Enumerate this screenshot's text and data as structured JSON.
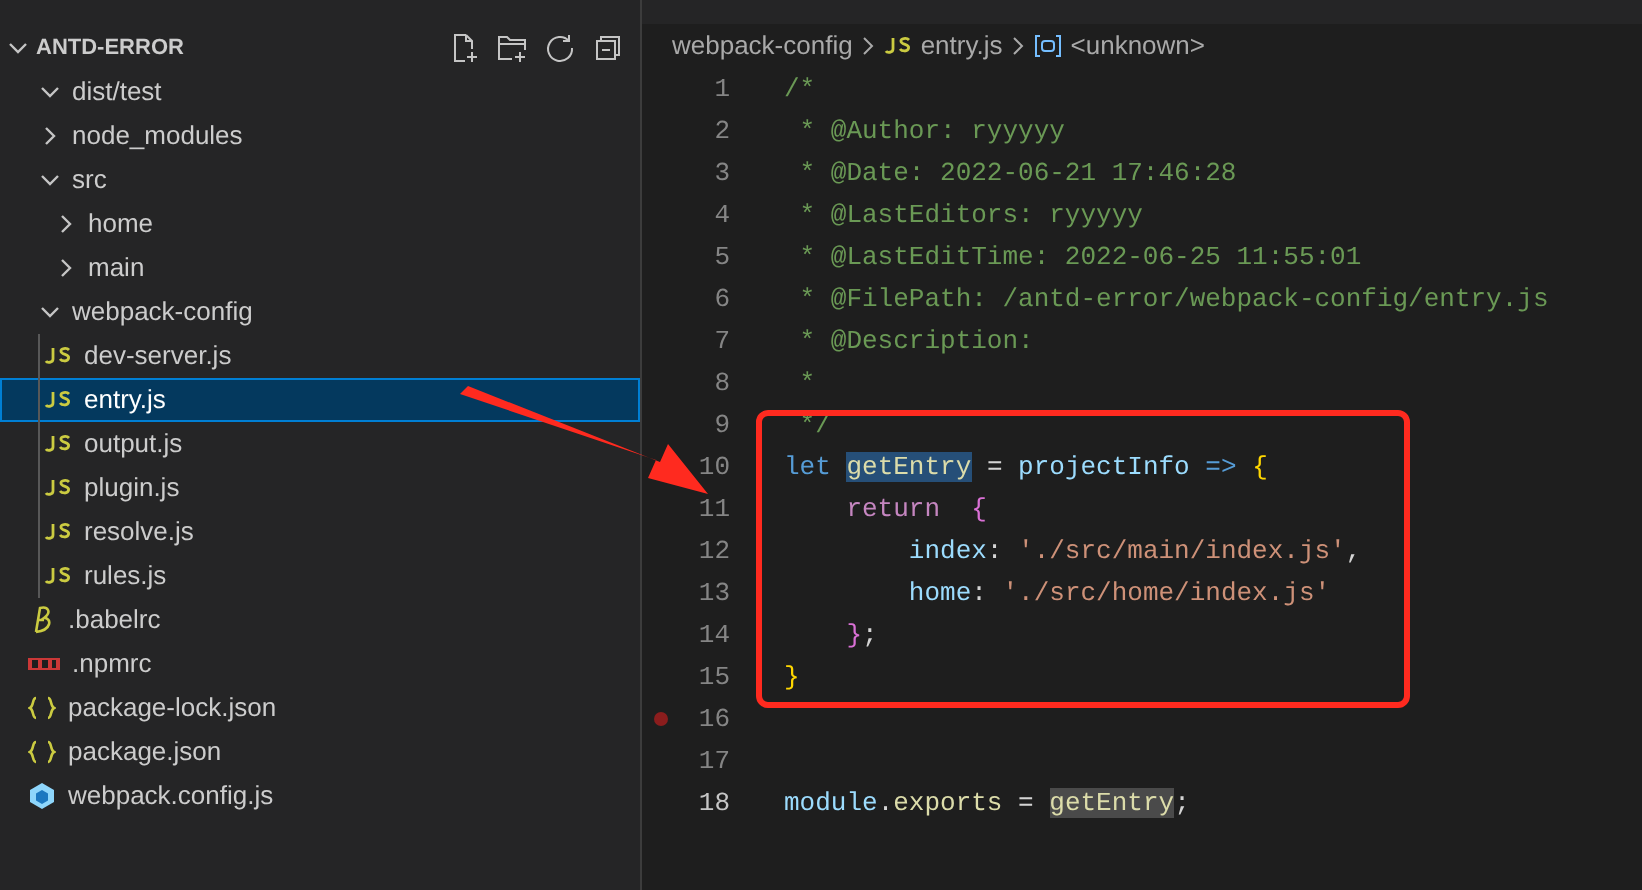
{
  "explorer": {
    "title": "ANTD-ERROR",
    "expanded": true,
    "tree": [
      {
        "name": "dist/test",
        "kind": "folder",
        "expanded": true,
        "selected": false
      },
      {
        "name": "node_modules",
        "kind": "folder",
        "expanded": false,
        "selected": false
      },
      {
        "name": "src",
        "kind": "folder",
        "expanded": true,
        "selected": false,
        "children": [
          {
            "name": "home",
            "kind": "folder",
            "expanded": false,
            "selected": false
          },
          {
            "name": "main",
            "kind": "folder",
            "expanded": false,
            "selected": false
          }
        ]
      },
      {
        "name": "webpack-config",
        "kind": "folder",
        "expanded": true,
        "selected": false,
        "children": [
          {
            "name": "dev-server.js",
            "kind": "js",
            "selected": false
          },
          {
            "name": "entry.js",
            "kind": "js",
            "selected": true
          },
          {
            "name": "output.js",
            "kind": "js",
            "selected": false
          },
          {
            "name": "plugin.js",
            "kind": "js",
            "selected": false
          },
          {
            "name": "resolve.js",
            "kind": "js",
            "selected": false
          },
          {
            "name": "rules.js",
            "kind": "js",
            "selected": false
          }
        ]
      },
      {
        "name": ".babelrc",
        "kind": "babel",
        "selected": false
      },
      {
        "name": ".npmrc",
        "kind": "npmrc",
        "selected": false
      },
      {
        "name": "package-lock.json",
        "kind": "json",
        "selected": false
      },
      {
        "name": "package.json",
        "kind": "json",
        "selected": false
      },
      {
        "name": "webpack.config.js",
        "kind": "webpack",
        "selected": false
      }
    ]
  },
  "breadcrumb": [
    {
      "text": "webpack-config",
      "kind": "folder"
    },
    {
      "text": "entry.js",
      "kind": "js"
    },
    {
      "text": "<unknown>",
      "kind": "symbol"
    }
  ],
  "code": [
    {
      "number": "1",
      "breakpoint": false,
      "current": false,
      "tokens": [
        {
          "text": "/*",
          "kind": "comment"
        }
      ]
    },
    {
      "number": "2",
      "breakpoint": false,
      "current": false,
      "tokens": [
        {
          "text": " * @Author: ryyyyy",
          "kind": "comment"
        }
      ]
    },
    {
      "number": "3",
      "breakpoint": false,
      "current": false,
      "tokens": [
        {
          "text": " * @Date: 2022-06-21 17:46:28",
          "kind": "comment"
        }
      ]
    },
    {
      "number": "4",
      "breakpoint": false,
      "current": false,
      "tokens": [
        {
          "text": " * @LastEditors: ryyyyy",
          "kind": "comment"
        }
      ]
    },
    {
      "number": "5",
      "breakpoint": false,
      "current": false,
      "tokens": [
        {
          "text": " * @LastEditTime: 2022-06-25 11:55:01",
          "kind": "comment"
        }
      ]
    },
    {
      "number": "6",
      "breakpoint": false,
      "current": false,
      "tokens": [
        {
          "text": " * @FilePath: /antd-error/webpack-config/entry.js",
          "kind": "comment"
        }
      ]
    },
    {
      "number": "7",
      "breakpoint": false,
      "current": false,
      "tokens": [
        {
          "text": " * @Description:",
          "kind": "comment"
        }
      ]
    },
    {
      "number": "8",
      "breakpoint": false,
      "current": false,
      "tokens": [
        {
          "text": " *",
          "kind": "comment"
        }
      ]
    },
    {
      "number": "9",
      "breakpoint": false,
      "current": false,
      "tokens": [
        {
          "text": " */",
          "kind": "comment"
        }
      ]
    },
    {
      "number": "10",
      "breakpoint": false,
      "current": false,
      "tokens": [
        {
          "text": "let ",
          "kind": "keyword"
        },
        {
          "text": "getEntry",
          "kind": "selected-var"
        },
        {
          "text": " = ",
          "kind": "plain"
        },
        {
          "text": "projectInfo ",
          "kind": "param"
        },
        {
          "text": "=> ",
          "kind": "keyword"
        },
        {
          "text": "{",
          "kind": "brace"
        }
      ]
    },
    {
      "number": "11",
      "breakpoint": false,
      "current": false,
      "tokens": [
        {
          "text": "    return  ",
          "kind": "control"
        },
        {
          "text": "{",
          "kind": "brace2"
        }
      ]
    },
    {
      "number": "12",
      "breakpoint": false,
      "current": false,
      "tokens": [
        {
          "text": "        index",
          "kind": "property"
        },
        {
          "text": ": ",
          "kind": "plain"
        },
        {
          "text": "'./src/main/index.js'",
          "kind": "string"
        },
        {
          "text": ",",
          "kind": "plain"
        }
      ]
    },
    {
      "number": "13",
      "breakpoint": false,
      "current": false,
      "tokens": [
        {
          "text": "        home",
          "kind": "property"
        },
        {
          "text": ": ",
          "kind": "plain"
        },
        {
          "text": "'./src/home/index.js'",
          "kind": "string"
        }
      ]
    },
    {
      "number": "14",
      "breakpoint": false,
      "current": false,
      "tokens": [
        {
          "text": "    }",
          "kind": "brace2"
        },
        {
          "text": ";",
          "kind": "plain"
        }
      ]
    },
    {
      "number": "15",
      "breakpoint": false,
      "current": false,
      "tokens": [
        {
          "text": "}",
          "kind": "brace"
        }
      ]
    },
    {
      "number": "16",
      "breakpoint": true,
      "current": false
    },
    {
      "number": "17",
      "breakpoint": false,
      "current": false
    },
    {
      "number": "18",
      "breakpoint": false,
      "current": true,
      "tokens": [
        {
          "text": "module",
          "kind": "param"
        },
        {
          "text": ".",
          "kind": "plain"
        },
        {
          "text": "exports",
          "kind": "function"
        },
        {
          "text": " = ",
          "kind": "plain"
        },
        {
          "text": "getEntry",
          "kind": "matched-var"
        },
        {
          "text": ";",
          "kind": "plain"
        }
      ]
    }
  ]
}
